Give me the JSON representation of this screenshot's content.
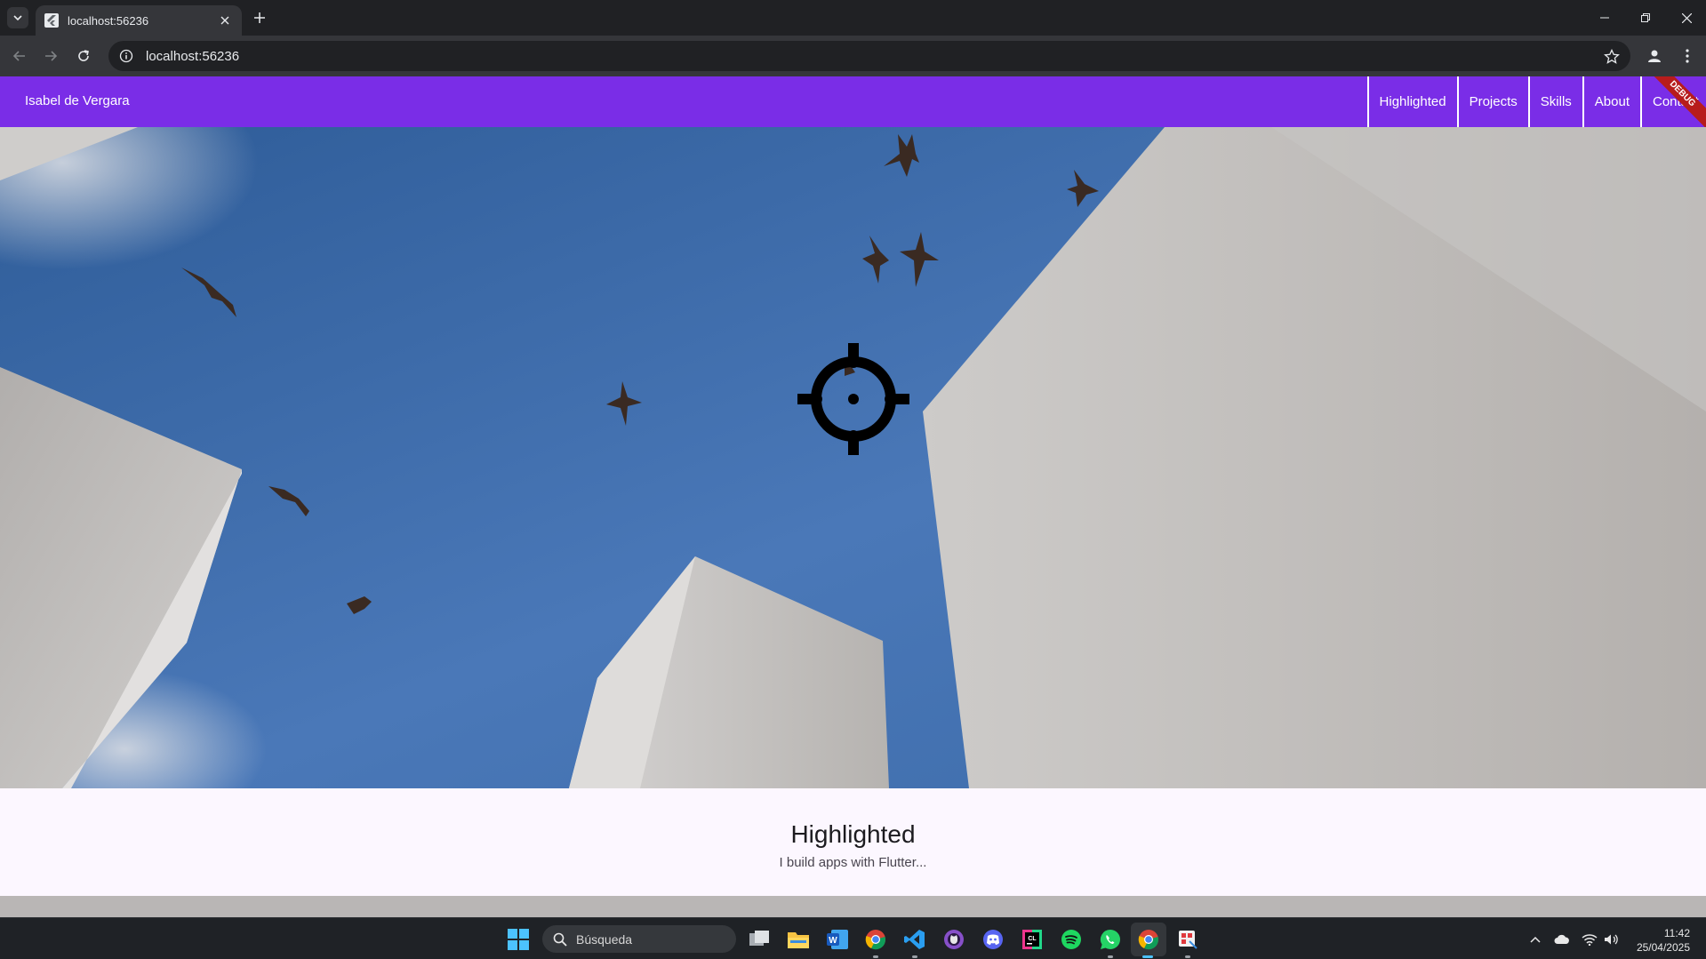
{
  "browser": {
    "tab_title": "localhost:56236",
    "url": "localhost:56236"
  },
  "app": {
    "title": "Isabel de Vergara",
    "nav_items": [
      "Highlighted",
      "Projects",
      "Skills",
      "About",
      "Contact"
    ],
    "debug_banner": "DEBUG",
    "accent_color": "#7a2de7"
  },
  "section": {
    "title": "Highlighted",
    "subtitle": "I build apps with Flutter..."
  },
  "taskbar": {
    "search_placeholder": "Búsqueda",
    "apps": [
      "task-view",
      "file-explorer",
      "word",
      "chrome",
      "vscode",
      "github-desktop",
      "discord",
      "clion",
      "spotify",
      "whatsapp",
      "chrome-active",
      "snipping-tool"
    ],
    "clock_time": "11:42",
    "clock_date": "25/04/2025"
  }
}
